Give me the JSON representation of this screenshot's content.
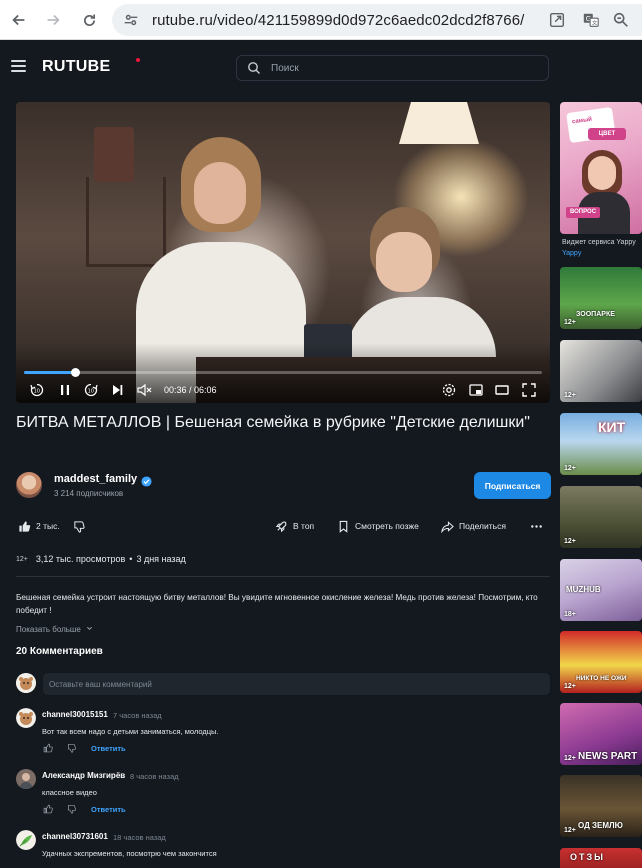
{
  "browser": {
    "url": "rutube.ru/video/421159899d0d972c6aedc02dcd2f8766/"
  },
  "header": {
    "logo": "RUTUBE",
    "search_placeholder": "Поиск"
  },
  "player": {
    "timecode": "00:36 / 06:06",
    "progress": 0.098
  },
  "video": {
    "title": "БИТВА МЕТАЛЛОВ | Бешеная семейка в рубрике \"Детские делишки\"",
    "channel_name": "maddest_family",
    "subscribers": "3 214 подписчиков",
    "subscribe_label": "Подписаться",
    "likes": "2 тыс.",
    "to_top_label": "В топ",
    "watch_later_label": "Смотреть позже",
    "share_label": "Поделиться",
    "age_rating": "12+",
    "views": "3,12 тыс. просмотров",
    "bullet": "•",
    "published": "3 дня назад",
    "description": "Бешеная семейка устроит настоящую битву металлов! Вы увидите мгновенное окисление железа! Медь против железа! Посмотрим, кто победит !",
    "show_more": "Показать больше"
  },
  "comments": {
    "title": "20 Комментариев",
    "input_placeholder": "Оставьте ваш комментарий",
    "reply_label": "Ответить",
    "items": [
      {
        "author": "channel30015151",
        "time": "7 часов назад",
        "text": "Вот так всем надо с детьми заниматься, молодцы."
      },
      {
        "author": "Александр Мизгирёв",
        "time": "8 часов назад",
        "text": "классное видео"
      },
      {
        "author": "channel30731601",
        "time": "18 часов назад",
        "text": "Удачных  экспрементов, посмотрю чем закончится"
      }
    ]
  },
  "sidebar": {
    "ad_title": "Виджет сервиса Yappy",
    "ad_source": "Yappy",
    "ad_overlay_1": "самый",
    "ad_overlay_2": "ЦВЕТ",
    "ad_overlay_3": "ВОПРОС",
    "items": [
      {
        "caption": "ЗООПАРКЕ",
        "badge": "12+"
      },
      {
        "caption": "",
        "badge": "12+"
      },
      {
        "caption": "КИТ",
        "badge": "12+"
      },
      {
        "caption": "",
        "badge": "12+"
      },
      {
        "caption": "MUZHUB",
        "badge": "18+"
      },
      {
        "caption": "НИКТО НЕ ОЖИ",
        "badge": "12+"
      },
      {
        "caption": "NEWS PART",
        "badge": "12+"
      },
      {
        "caption": "ОД ЗЕМЛЮ",
        "badge": "12+"
      },
      {
        "caption": "ОТЗЫ",
        "badge": ""
      }
    ]
  },
  "colors": {
    "background": "#14191f",
    "accent": "#1e88e5",
    "link": "#3fa5ff",
    "brand_dot": "#ed143d"
  }
}
